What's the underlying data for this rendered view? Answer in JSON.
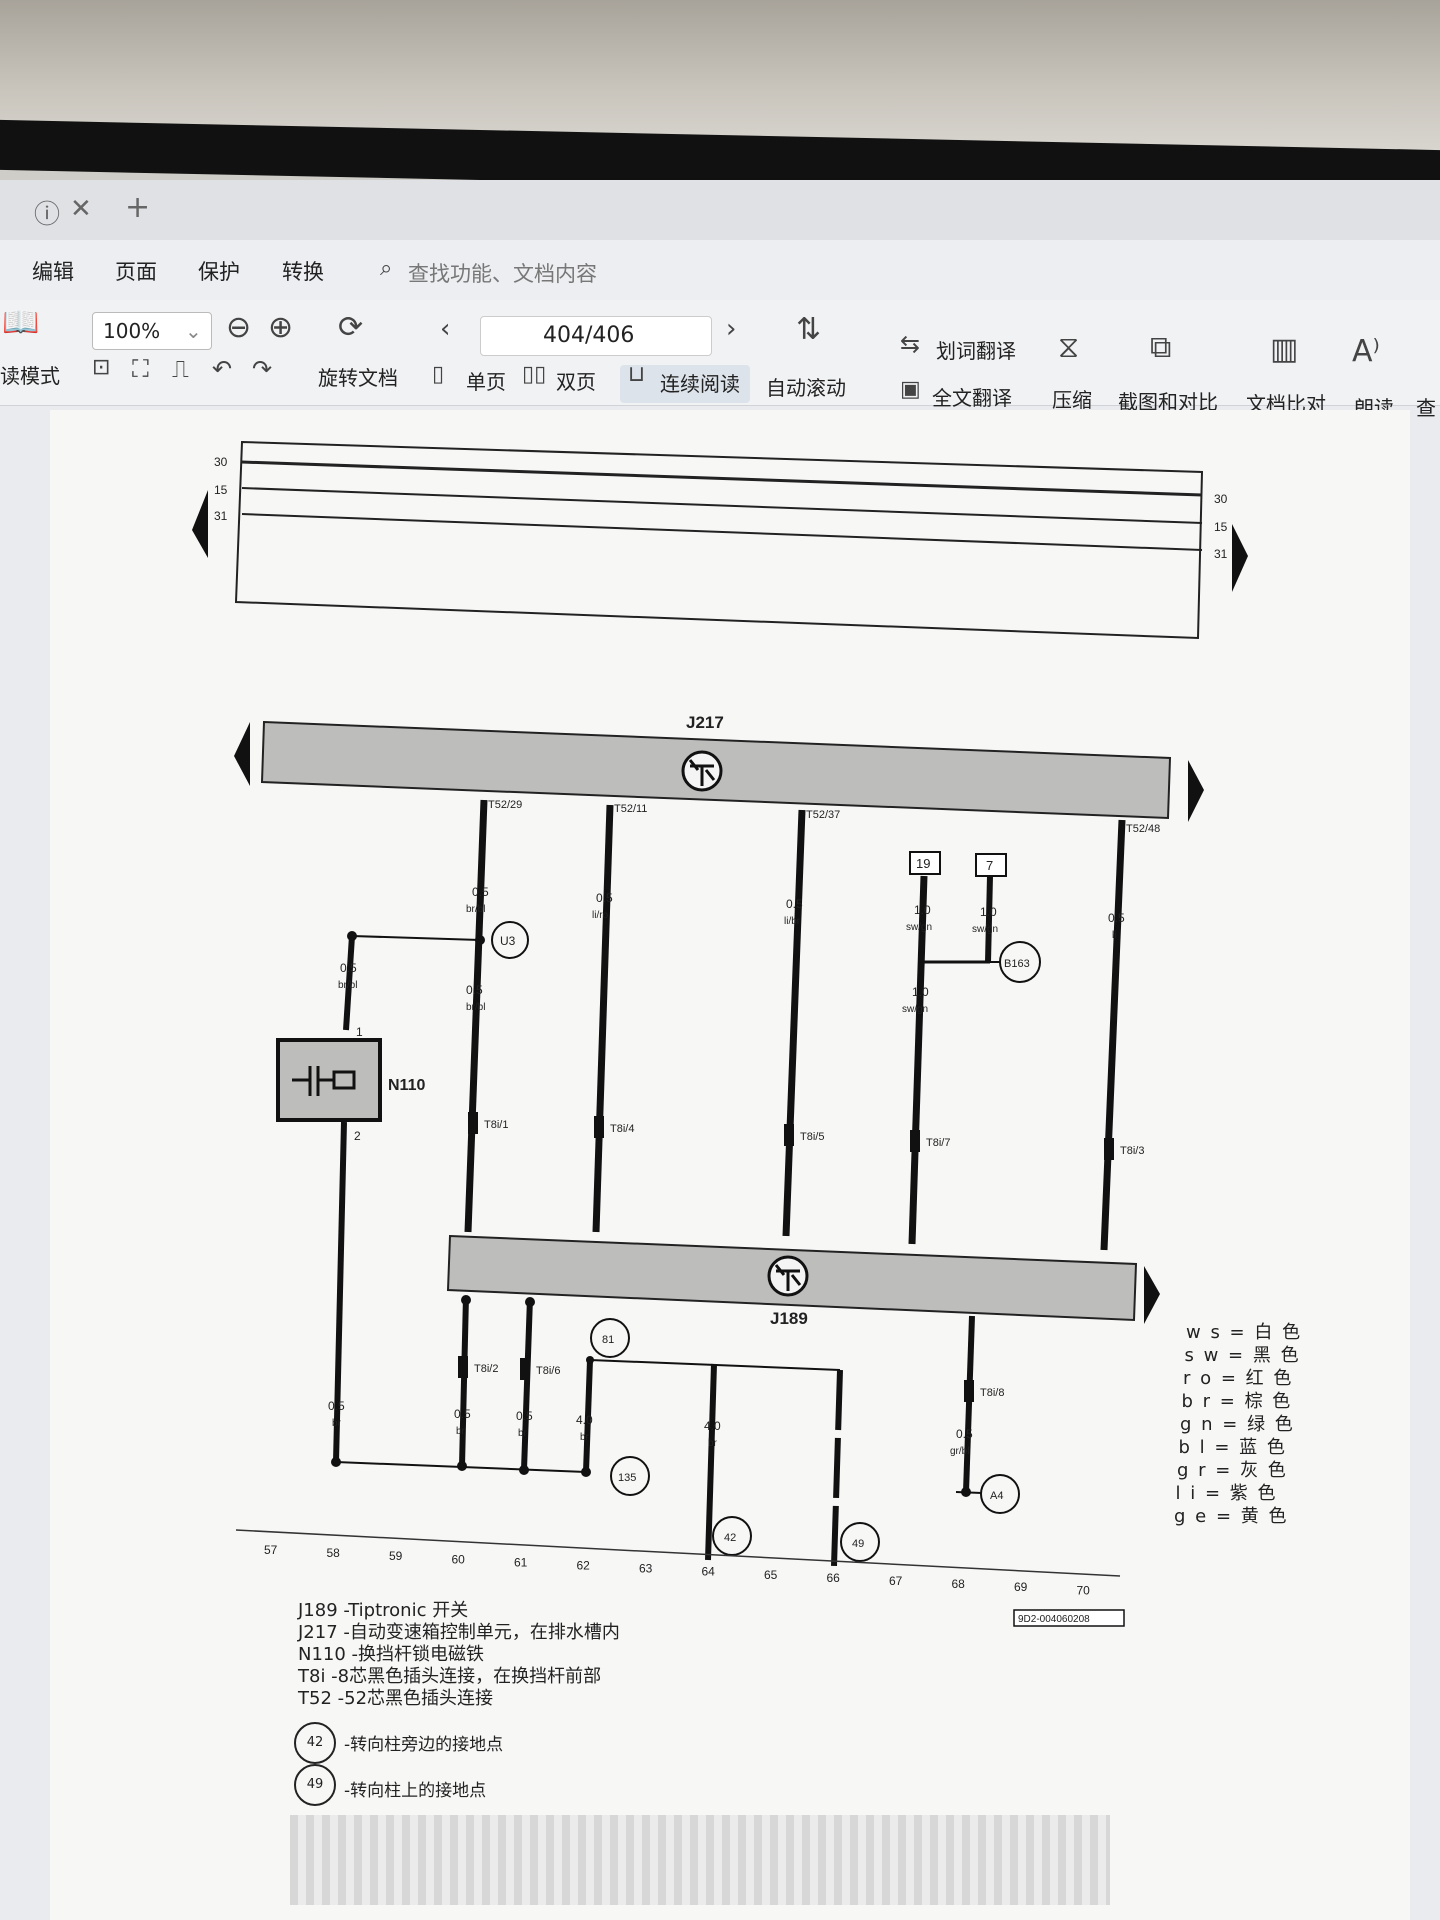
{
  "tabbar": {
    "new_tab": "+"
  },
  "menu": [
    "编辑",
    "页面",
    "保护",
    "转换"
  ],
  "search": {
    "placeholder": "查找功能、文档内容"
  },
  "toolbar": {
    "read_mode": "读模式",
    "zoom": "100%",
    "rotate": "旋转文档",
    "page_indicator": "404/406",
    "single_page": "单页",
    "double_page": "双页",
    "continuous": "连续阅读",
    "auto_scroll": "自动滚动",
    "word_translate": "划词翻译",
    "full_translate": "全文翻译",
    "compress": "压缩",
    "screenshot_compare": "截图和对比",
    "doc_compare": "文档比对",
    "read_aloud": "朗读",
    "more": "查"
  },
  "diagram": {
    "rails": [
      "30",
      "15",
      "31"
    ],
    "units": {
      "top": "J217",
      "bottom": "J189",
      "n110": "N110"
    },
    "pins_top": [
      "T52/29",
      "T52/11",
      "T52/37",
      "T52/48"
    ],
    "wires": [
      {
        "size": "0.5",
        "color": "br/bl"
      },
      {
        "size": "0.5",
        "color": "li/ro"
      },
      {
        "size": "0.5",
        "color": "li/br"
      },
      {
        "size": "1.0",
        "color": "sw/gn"
      },
      {
        "size": "1.0",
        "color": "sw/gn"
      },
      {
        "size": "0.5",
        "color": "li"
      }
    ],
    "boxes": [
      "19",
      "7"
    ],
    "circles": [
      "U3",
      "B163",
      "81",
      "135",
      "42",
      "49",
      "A4"
    ],
    "connectors": [
      "T8i/1",
      "T8i/4",
      "T8i/5",
      "T8i/7",
      "T8i/3",
      "T8i/2",
      "T8i/6",
      "T8i/8"
    ],
    "bottom_wires": [
      {
        "size": "0.5",
        "color": "br"
      },
      {
        "size": "0.5",
        "color": "br"
      },
      {
        "size": "0.5",
        "color": "br"
      },
      {
        "size": "4.0",
        "color": "br"
      },
      {
        "size": "4.0",
        "color": "br"
      },
      {
        "size": "0.5",
        "color": "gr/bl"
      }
    ],
    "n110_pins": [
      "1",
      "2"
    ],
    "scale": [
      "57",
      "58",
      "59",
      "60",
      "61",
      "62",
      "63",
      "64",
      "65",
      "66",
      "67",
      "68",
      "69",
      "70"
    ],
    "code": "9D2-004060208"
  },
  "legend": [
    "w s = 白 色",
    "s w = 黑 色",
    "r o = 红 色",
    "b r = 棕 色",
    "g n = 绿 色",
    "b l = 蓝 色",
    "g r = 灰 色",
    "l i = 紫 色",
    "g e = 黄 色"
  ],
  "captions": [
    "J189 -Tiptronic 开关",
    "J217 -自动变速箱控制单元，在排水槽内",
    "N110 -换挡杆锁电磁铁",
    "T8i   -8芯黑色插头连接，在换挡杆前部",
    "T52   -52芯黑色插头连接"
  ],
  "ground_notes": [
    {
      "id": "42",
      "text": "-转向柱旁边的接地点"
    },
    {
      "id": "49",
      "text": "-转向柱上的接地点"
    }
  ]
}
